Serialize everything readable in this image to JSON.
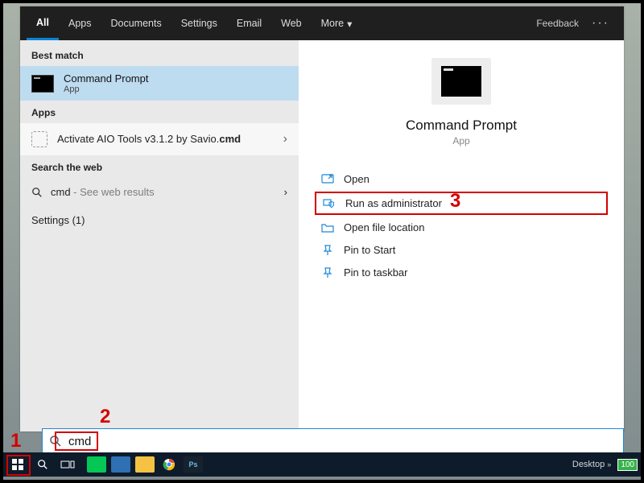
{
  "tabs": {
    "items": [
      "All",
      "Apps",
      "Documents",
      "Settings",
      "Email",
      "Web",
      "More"
    ],
    "more_chevron": "▾",
    "feedback": "Feedback"
  },
  "left": {
    "best_match_label": "Best match",
    "best_match": {
      "title": "Command Prompt",
      "subtitle": "App"
    },
    "apps_label": "Apps",
    "apps_item": {
      "label": "Activate AIO Tools v3.1.2 by Savio.cmd"
    },
    "web_label": "Search the web",
    "web_item": {
      "term": "cmd",
      "suffix": " - See web results"
    },
    "settings_label": "Settings (1)"
  },
  "right": {
    "title": "Command Prompt",
    "subtitle": "App",
    "actions": [
      "Open",
      "Run as administrator",
      "Open file location",
      "Pin to Start",
      "Pin to taskbar"
    ]
  },
  "search": {
    "value": "cmd"
  },
  "taskbar": {
    "desktop_label": "Desktop",
    "battery": "100"
  },
  "annotations": {
    "a1": "1",
    "a2": "2",
    "a3": "3"
  },
  "colors": {
    "accent": "#0a84d6",
    "highlight": "#bedcf0",
    "anno": "#d40000"
  }
}
